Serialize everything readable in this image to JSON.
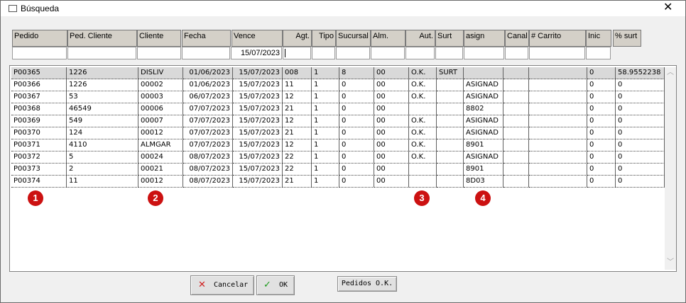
{
  "window": {
    "title": "Búsqueda"
  },
  "columns": [
    {
      "key": "pedido",
      "label": "Pedido"
    },
    {
      "key": "ped_cliente",
      "label": "Ped. Cliente"
    },
    {
      "key": "cliente",
      "label": "Cliente"
    },
    {
      "key": "fecha",
      "label": "Fecha"
    },
    {
      "key": "vence",
      "label": "Vence"
    },
    {
      "key": "agt",
      "label": "Agt."
    },
    {
      "key": "tipo",
      "label": "Tipo"
    },
    {
      "key": "sucursal",
      "label": "Sucursal"
    },
    {
      "key": "alm",
      "label": "Alm."
    },
    {
      "key": "aut",
      "label": "Aut."
    },
    {
      "key": "surt",
      "label": "Surt"
    },
    {
      "key": "asign",
      "label": "asign"
    },
    {
      "key": "canal",
      "label": "Canal"
    },
    {
      "key": "carrito",
      "label": "# Carrito"
    },
    {
      "key": "inic",
      "label": "Inic"
    },
    {
      "key": "pct_surt",
      "label": "% surt"
    }
  ],
  "filters": {
    "vence": "15/07/2023"
  },
  "rows": [
    [
      "P00365",
      "1226",
      "DISLIV",
      "01/06/2023",
      "15/07/2023",
      "008",
      "1",
      "8",
      "00",
      "O.K.",
      "SURT",
      "",
      "",
      "",
      "0",
      "58.9552238"
    ],
    [
      "P00366",
      "1226",
      "00002",
      "01/06/2023",
      "15/07/2023",
      "11",
      "1",
      "0",
      "00",
      "O.K.",
      "",
      "ASIGNAD",
      "",
      "",
      "0",
      "0"
    ],
    [
      "P00367",
      "53",
      "00003",
      "06/07/2023",
      "15/07/2023",
      "12",
      "1",
      "0",
      "00",
      "O.K.",
      "",
      "ASIGNAD",
      "",
      "",
      "0",
      "0"
    ],
    [
      "P00368",
      "46549",
      "00006",
      "07/07/2023",
      "15/07/2023",
      "21",
      "1",
      "0",
      "00",
      "",
      "",
      "8802",
      "",
      "",
      "0",
      "0"
    ],
    [
      "P00369",
      "549",
      "00007",
      "07/07/2023",
      "15/07/2023",
      "12",
      "1",
      "0",
      "00",
      "O.K.",
      "",
      "ASIGNAD",
      "",
      "",
      "0",
      "0"
    ],
    [
      "P00370",
      "124",
      "00012",
      "07/07/2023",
      "15/07/2023",
      "21",
      "1",
      "0",
      "00",
      "O.K.",
      "",
      "ASIGNAD",
      "",
      "",
      "0",
      "0"
    ],
    [
      "P00371",
      "4110",
      "ALMGAR",
      "07/07/2023",
      "15/07/2023",
      "12",
      "1",
      "0",
      "00",
      "O.K.",
      "",
      "8901",
      "",
      "",
      "0",
      "0"
    ],
    [
      "P00372",
      "5",
      "00024",
      "08/07/2023",
      "15/07/2023",
      "22",
      "1",
      "0",
      "00",
      "O.K.",
      "",
      "ASIGNAD",
      "",
      "",
      "0",
      "0"
    ],
    [
      "P00373",
      "2",
      "00021",
      "08/07/2023",
      "15/07/2023",
      "22",
      "1",
      "0",
      "00",
      "",
      "",
      "8901",
      "",
      "",
      "0",
      "0"
    ],
    [
      "P00374",
      "11",
      "00012",
      "08/07/2023",
      "15/07/2023",
      "21",
      "1",
      "0",
      "00",
      "",
      "",
      "8D03",
      "",
      "",
      "0",
      "0"
    ]
  ],
  "markers": [
    "1",
    "2",
    "3",
    "4"
  ],
  "buttons": {
    "cancel": "Cancelar",
    "ok": "OK",
    "pedidos_ok": "Pedidos O.K."
  },
  "colors": {
    "marker": "#cc1111",
    "selected_row": "#d9d9d9",
    "header_bg": "#d4d0c8",
    "cancel_icon": "#d02020",
    "ok_icon": "#1a9a1a"
  }
}
